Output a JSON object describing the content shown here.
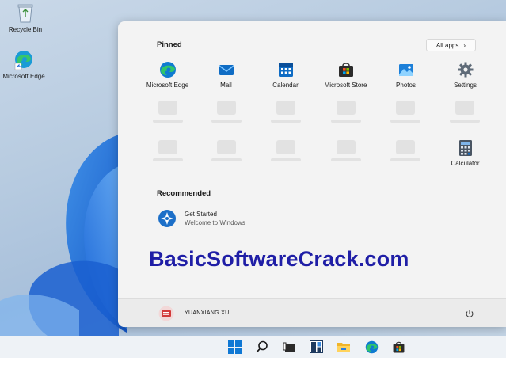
{
  "desktop": {
    "icons": [
      {
        "label": "Recycle Bin",
        "icon": "recycle-bin-icon"
      },
      {
        "label": "Microsoft Edge",
        "icon": "edge-icon"
      }
    ]
  },
  "start_menu": {
    "pinned_title": "Pinned",
    "all_apps_label": "All apps",
    "all_apps_chevron": "›",
    "pinned": [
      {
        "label": "Microsoft Edge",
        "icon": "edge-icon"
      },
      {
        "label": "Mail",
        "icon": "mail-icon"
      },
      {
        "label": "Calendar",
        "icon": "calendar-icon"
      },
      {
        "label": "Microsoft Store",
        "icon": "store-icon"
      },
      {
        "label": "Photos",
        "icon": "photos-icon"
      },
      {
        "label": "Settings",
        "icon": "gear-icon"
      }
    ],
    "calculator_label": "Calculator",
    "recommended_title": "Recommended",
    "recommended": [
      {
        "title": "Get Started",
        "subtitle": "Welcome to Windows",
        "icon": "get-started-icon"
      }
    ],
    "user": {
      "name": "YUANXIANG XU",
      "avatar": "avatar"
    },
    "power_icon": "power-icon"
  },
  "watermark": "BasicSoftwareCrack.com",
  "taskbar": {
    "icons": [
      "start-icon",
      "search-icon",
      "task-view-icon",
      "widgets-icon",
      "file-explorer-icon",
      "edge-icon",
      "store-icon"
    ]
  },
  "colors": {
    "accent": "#0078d4",
    "watermark": "#1f1ea6",
    "menu_bg": "#f3f3f3"
  }
}
